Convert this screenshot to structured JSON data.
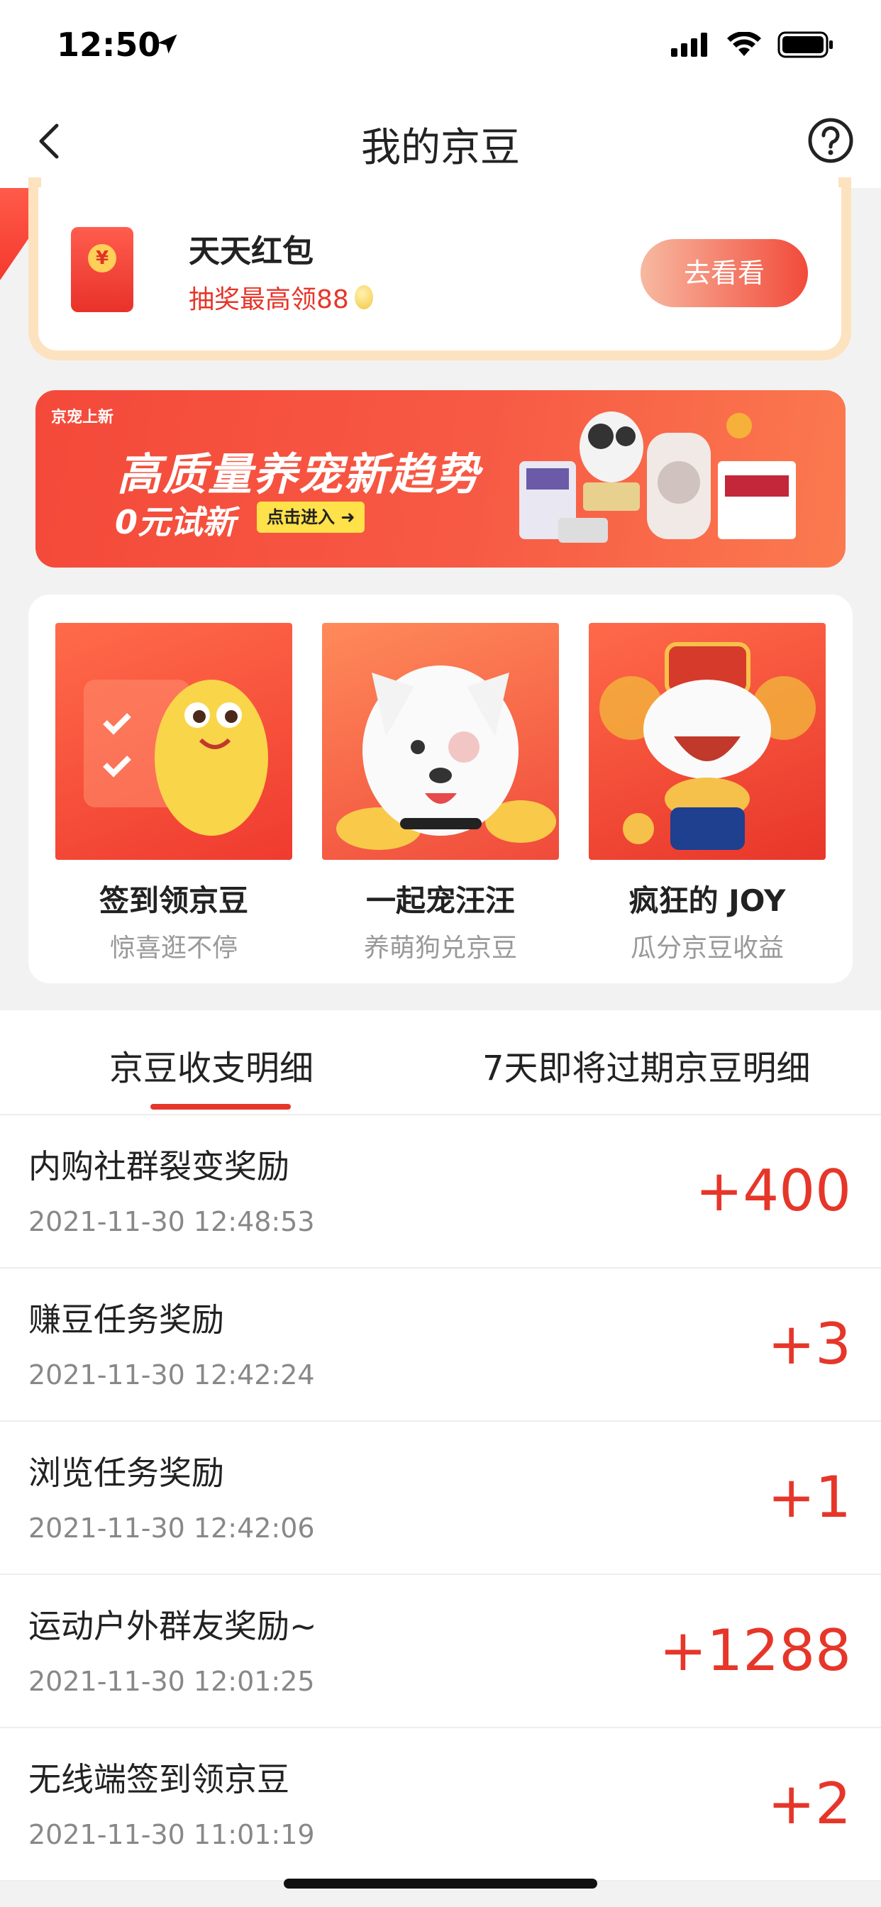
{
  "status_bar": {
    "time": "12:50"
  },
  "nav": {
    "title": "我的京豆"
  },
  "hongbao": {
    "title": "天天红包",
    "subtitle": "抽奖最高领88",
    "coin_symbol": "¥",
    "button": "去看看"
  },
  "banner": {
    "logo_text": "京宠上新",
    "title": "高质量养宠新趋势",
    "subtitle": "0元试新",
    "cta": "点击进入"
  },
  "games": [
    {
      "name": "签到领京豆",
      "desc": "惊喜逛不停"
    },
    {
      "name": "一起宠汪汪",
      "desc": "养萌狗兑京豆"
    },
    {
      "name": "疯狂的 JOY",
      "desc": "瓜分京豆收益"
    }
  ],
  "tabs": [
    {
      "label": "京豆收支明细",
      "active": true
    },
    {
      "label": "7天即将过期京豆明细",
      "active": false
    }
  ],
  "records": [
    {
      "title": "内购社群裂变奖励",
      "time": "2021-11-30 12:48:53",
      "amount": "+400"
    },
    {
      "title": "赚豆任务奖励",
      "time": "2021-11-30 12:42:24",
      "amount": "+3"
    },
    {
      "title": "浏览任务奖励",
      "time": "2021-11-30 12:42:06",
      "amount": "+1"
    },
    {
      "title": "运动户外群友奖励~",
      "time": "2021-11-30 12:01:25",
      "amount": "+1288"
    },
    {
      "title": "无线端签到领京豆",
      "time": "2021-11-30 11:01:19",
      "amount": "+2"
    }
  ],
  "colors": {
    "accent": "#e6362a",
    "banner": "#f4493a",
    "button_gradient_end": "#f24a3a"
  }
}
